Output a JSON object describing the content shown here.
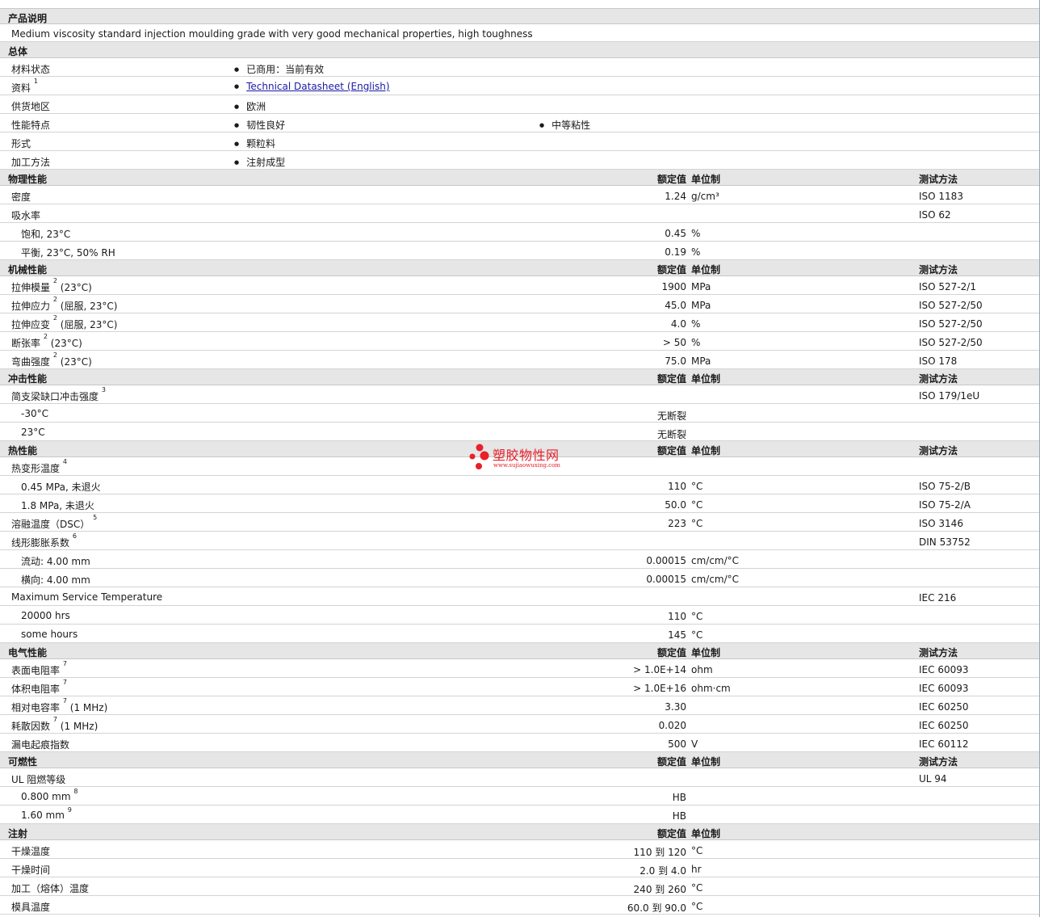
{
  "sections": [
    {
      "title": "产品说明",
      "kind": "note",
      "note": "Medium viscosity standard injection moulding grade with very good mechanical properties, high toughness"
    },
    {
      "title": "总体",
      "kind": "general",
      "rows": [
        {
          "label": "材料状态",
          "items": [
            "已商用：当前有效"
          ]
        },
        {
          "label": "资料",
          "sup": "1",
          "items": [
            "Technical Datasheet (English)"
          ],
          "link": true
        },
        {
          "label": "供货地区",
          "items": [
            "欧洲"
          ]
        },
        {
          "label": "性能特点",
          "items": [
            "韧性良好",
            "中等粘性"
          ]
        },
        {
          "label": "形式",
          "items": [
            "颗粒料"
          ]
        },
        {
          "label": "加工方法",
          "items": [
            "注射成型"
          ]
        }
      ]
    },
    {
      "title": "物理性能",
      "kind": "props",
      "rows": [
        {
          "label": "密度",
          "value": "1.24",
          "unit": "g/cm³",
          "method": "ISO 1183"
        },
        {
          "label": "吸水率",
          "method": "ISO 62"
        },
        {
          "label": "饱和, 23°C",
          "indent": true,
          "value": "0.45",
          "unit": "%"
        },
        {
          "label": "平衡, 23°C, 50% RH",
          "indent": true,
          "value": "0.19",
          "unit": "%"
        }
      ]
    },
    {
      "title": "机械性能",
      "kind": "props",
      "rows": [
        {
          "label": "拉伸模量",
          "sup": "2",
          "suffix": "(23°C)",
          "value": "1900",
          "unit": "MPa",
          "method": "ISO 527-2/1"
        },
        {
          "label": "拉伸应力",
          "sup": "2",
          "suffix": "(屈服, 23°C)",
          "value": "45.0",
          "unit": "MPa",
          "method": "ISO 527-2/50"
        },
        {
          "label": "拉伸应变",
          "sup": "2",
          "suffix": "(屈服, 23°C)",
          "value": "4.0",
          "unit": "%",
          "method": "ISO 527-2/50"
        },
        {
          "label": "断张率",
          "sup": "2",
          "suffix": "(23°C)",
          "value": "> 50",
          "unit": "%",
          "method": "ISO 527-2/50"
        },
        {
          "label": "弯曲强度",
          "sup": "2",
          "suffix": "(23°C)",
          "value": "75.0",
          "unit": "MPa",
          "method": "ISO 178"
        }
      ]
    },
    {
      "title": "冲击性能",
      "kind": "props",
      "rows": [
        {
          "label": "简支梁缺口冲击强度",
          "sup": "3",
          "method": "ISO 179/1eU"
        },
        {
          "label": "-30°C",
          "indent": true,
          "value": "无断裂"
        },
        {
          "label": "23°C",
          "indent": true,
          "value": "无断裂"
        }
      ]
    },
    {
      "title": "热性能",
      "kind": "props",
      "rows": [
        {
          "label": "热变形温度",
          "sup": "4"
        },
        {
          "label": "0.45 MPa, 未退火",
          "indent": true,
          "value": "110",
          "unit": "°C",
          "method": "ISO 75-2/B"
        },
        {
          "label": "1.8 MPa, 未退火",
          "indent": true,
          "value": "50.0",
          "unit": "°C",
          "method": "ISO 75-2/A"
        },
        {
          "label": "溶融温度（DSC）",
          "sup": "5",
          "value": "223",
          "unit": "°C",
          "method": "ISO 3146"
        },
        {
          "label": "线形膨胀系数",
          "sup": "6",
          "method": "DIN 53752"
        },
        {
          "label": "流动: 4.00 mm",
          "indent": true,
          "value": "0.00015",
          "unit": "cm/cm/°C"
        },
        {
          "label": "横向: 4.00 mm",
          "indent": true,
          "value": "0.00015",
          "unit": "cm/cm/°C"
        },
        {
          "label": "Maximum Service Temperature",
          "method": "IEC 216"
        },
        {
          "label": "20000 hrs",
          "indent": true,
          "value": "110",
          "unit": "°C"
        },
        {
          "label": "some hours",
          "indent": true,
          "value": "145",
          "unit": "°C"
        }
      ]
    },
    {
      "title": "电气性能",
      "kind": "props",
      "rows": [
        {
          "label": "表面电阻率",
          "sup": "7",
          "value": "> 1.0E+14",
          "unit": "ohm",
          "method": "IEC 60093"
        },
        {
          "label": "体积电阻率",
          "sup": "7",
          "value": "> 1.0E+16",
          "unit": "ohm·cm",
          "method": "IEC 60093"
        },
        {
          "label": "相对电容率",
          "sup": "7",
          "suffix": "(1 MHz)",
          "value": "3.30",
          "method": "IEC 60250"
        },
        {
          "label": "耗散因数",
          "sup": "7",
          "suffix": "(1 MHz)",
          "value": "0.020",
          "method": "IEC 60250"
        },
        {
          "label": "漏电起痕指数",
          "value": "500",
          "unit": "V",
          "method": "IEC 60112"
        }
      ]
    },
    {
      "title": "可燃性",
      "kind": "props",
      "rows": [
        {
          "label": "UL 阻燃等级",
          "method": "UL 94"
        },
        {
          "label": "0.800 mm",
          "sup": "8",
          "indent": true,
          "value": "HB"
        },
        {
          "label": "1.60 mm",
          "sup": "9",
          "indent": true,
          "value": "HB"
        }
      ]
    },
    {
      "title": "注射",
      "kind": "props",
      "hideMethod": true,
      "rows": [
        {
          "label": "干燥温度",
          "value": "110 到 120",
          "unit": "°C"
        },
        {
          "label": "干燥时间",
          "value": "2.0 到 4.0",
          "unit": "hr"
        },
        {
          "label": "加工（熔体）温度",
          "value": "240 到 260",
          "unit": "°C"
        },
        {
          "label": "模具温度",
          "value": "60.0 到 90.0",
          "unit": "°C"
        }
      ]
    }
  ],
  "columns": {
    "value": "额定值",
    "unit": "单位制",
    "method": "测试方法"
  },
  "watermark": {
    "title": "塑胶物性网",
    "url": "www.sujiaowuxing.com"
  },
  "colors": {
    "header_bg": "#e6e6e6",
    "grid": "#d4d4d4",
    "link": "#1a1aa6",
    "watermark": "#e8202a"
  }
}
